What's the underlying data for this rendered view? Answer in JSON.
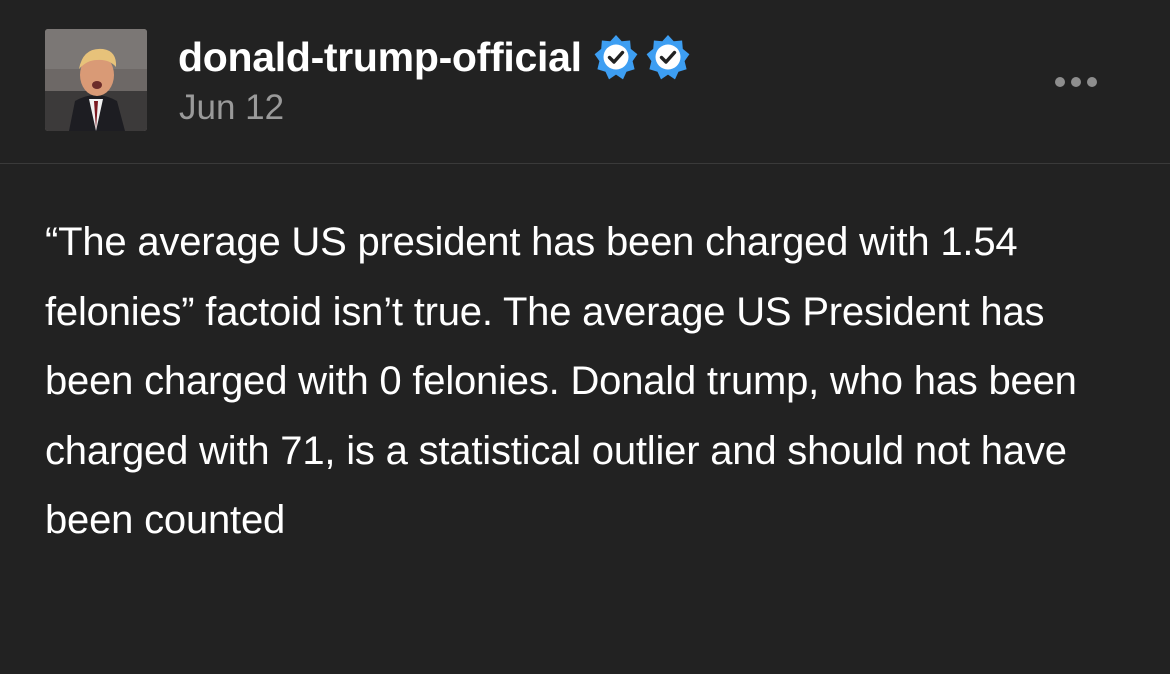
{
  "post": {
    "username": "donald-trump-official",
    "date": "Jun 12",
    "body": "“The average US president has been charged with 1.54 felonies” factoid isn’t true. The average US President has been charged with 0 felonies. Donald trump, who has been charged with 71, is a statistical outlier and should not have been counted",
    "badges": [
      "verified-badge-icon",
      "verified-badge-icon"
    ],
    "more_icon": "ellipsis-icon"
  },
  "colors": {
    "background": "#222222",
    "text": "#ffffff",
    "date": "#9a9a9a",
    "badge": "#3d9ef2",
    "divider": "#3a3a3a",
    "more_dots": "#8e8e8e"
  }
}
